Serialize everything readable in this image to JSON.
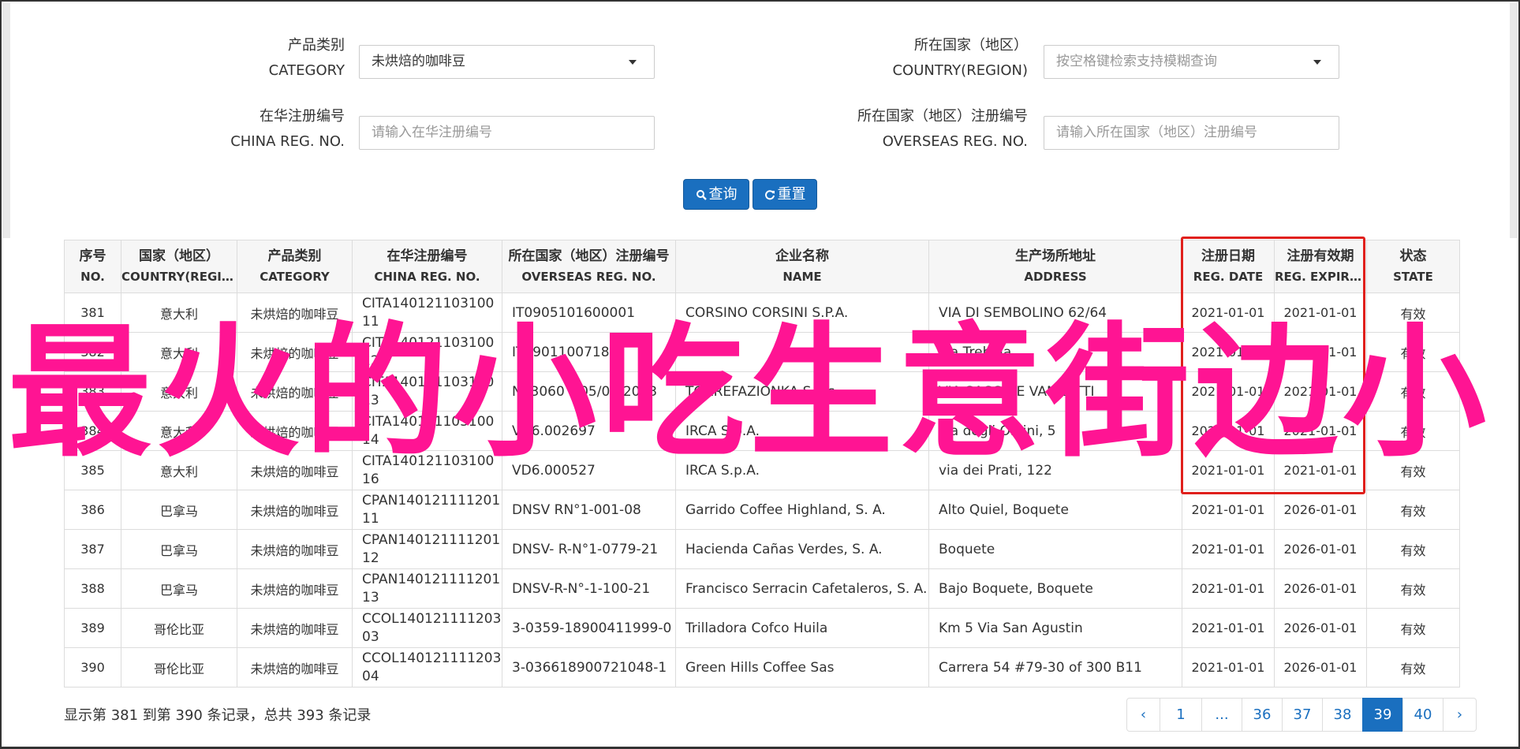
{
  "filters": {
    "category": {
      "label_cn": "产品类别",
      "label_en": "CATEGORY",
      "value": "未烘焙的咖啡豆"
    },
    "country": {
      "label_cn": "所在国家（地区）",
      "label_en": "COUNTRY(REGION)",
      "placeholder": "按空格键检索支持模糊查询"
    },
    "china_reg": {
      "label_cn": "在华注册编号",
      "label_en": "CHINA REG. NO.",
      "placeholder": "请输入在华注册编号"
    },
    "overseas_reg": {
      "label_cn": "所在国家（地区）注册编号",
      "label_en": "OVERSEAS REG. NO.",
      "placeholder": "请输入所在国家（地区）注册编号"
    },
    "search_label": "查询",
    "reset_label": "重置"
  },
  "table": {
    "headers": [
      {
        "cn": "序号",
        "en": "NO."
      },
      {
        "cn": "国家（地区）",
        "en": "COUNTRY(REGIO…"
      },
      {
        "cn": "产品类别",
        "en": "CATEGORY"
      },
      {
        "cn": "在华注册编号",
        "en": "CHINA REG. NO."
      },
      {
        "cn": "所在国家（地区）注册编号",
        "en": "OVERSEAS REG. NO."
      },
      {
        "cn": "企业名称",
        "en": "NAME"
      },
      {
        "cn": "生产场所地址",
        "en": "ADDRESS"
      },
      {
        "cn": "注册日期",
        "en": "REG. DATE"
      },
      {
        "cn": "注册有效期",
        "en": "REG. EXPIRE …"
      },
      {
        "cn": "状态",
        "en": "STATE"
      }
    ],
    "rows": [
      {
        "no": "381",
        "country": "意大利",
        "category": "未烘焙的咖啡豆",
        "china_reg": "CITA14012110310011",
        "overseas_reg": "IT0905101600001",
        "name": "CORSINO CORSINI S.P.A.",
        "address": "VIA DI SEMBOLINO 62/64",
        "reg_date": "2021-01-01",
        "expire": "2021-01-01",
        "state": "有效"
      },
      {
        "no": "382",
        "country": "意大利",
        "category": "未烘焙的咖啡豆",
        "china_reg": "CITA14012110310012",
        "overseas_reg": "IT0901100718",
        "name": "",
        "address": "via Trebbia",
        "reg_date": "2021-01-01",
        "expire": "2021-01-01",
        "state": "有效"
      },
      {
        "no": "383",
        "country": "意大利",
        "category": "未烘焙的咖啡豆",
        "china_reg": "CITA14012110310013",
        "overseas_reg": "N. 3060 – 05/07/2013",
        "name": "TORREFAZIONKA S.a.s.",
        "address": "VIA SACCO E VANZETTI",
        "reg_date": "2021-01-01",
        "expire": "2021-01-01",
        "state": "有效"
      },
      {
        "no": "384",
        "country": "意大利",
        "category": "未烘焙的咖啡豆",
        "china_reg": "CITA14012110310014",
        "overseas_reg": "VD6.002697",
        "name": "IRCA S.p.A.",
        "address": "via degli Orsini, 5",
        "reg_date": "2021-01-01",
        "expire": "2021-01-01",
        "state": "有效"
      },
      {
        "no": "385",
        "country": "意大利",
        "category": "未烘焙的咖啡豆",
        "china_reg": "CITA14012110310016",
        "overseas_reg": "VD6.000527",
        "name": "IRCA S.p.A.",
        "address": "via dei Prati, 122",
        "reg_date": "2021-01-01",
        "expire": "2021-01-01",
        "state": "有效"
      },
      {
        "no": "386",
        "country": "巴拿马",
        "category": "未烘焙的咖啡豆",
        "china_reg": "CPAN14012111120111",
        "overseas_reg": "DNSV RN°1-001-08",
        "name": "Garrido Coffee Highland, S. A.",
        "address": "Alto Quiel, Boquete",
        "reg_date": "2021-01-01",
        "expire": "2026-01-01",
        "state": "有效"
      },
      {
        "no": "387",
        "country": "巴拿马",
        "category": "未烘焙的咖啡豆",
        "china_reg": "CPAN14012111120112",
        "overseas_reg": "DNSV- R-N°1-0779-21",
        "name": "Hacienda Cañas Verdes, S. A.",
        "address": "Boquete",
        "reg_date": "2021-01-01",
        "expire": "2026-01-01",
        "state": "有效"
      },
      {
        "no": "388",
        "country": "巴拿马",
        "category": "未烘焙的咖啡豆",
        "china_reg": "CPAN14012111120113",
        "overseas_reg": "DNSV-R-N°-1-100-21",
        "name": "Francisco Serracin Cafetaleros, S. A.",
        "address": "Bajo Boquete, Boquete",
        "reg_date": "2021-01-01",
        "expire": "2026-01-01",
        "state": "有效"
      },
      {
        "no": "389",
        "country": "哥伦比亚",
        "category": "未烘焙的咖啡豆",
        "china_reg": "CCOL14012111120303",
        "overseas_reg": "3-0359-18900411999-0",
        "name": "Trilladora Cofco Huila",
        "address": "Km 5 Via San Agustin",
        "reg_date": "2021-01-01",
        "expire": "2026-01-01",
        "state": "有效"
      },
      {
        "no": "390",
        "country": "哥伦比亚",
        "category": "未烘焙的咖啡豆",
        "china_reg": "CCOL14012111120304",
        "overseas_reg": "3-036618900721048-1",
        "name": "Green Hills Coffee Sas",
        "address": "Carrera 54 #79-30 of 300 B11",
        "reg_date": "2021-01-01",
        "expire": "2026-01-01",
        "state": "有效"
      }
    ]
  },
  "summary": "显示第 381 到第 390 条记录，总共 393 条记录",
  "pager": [
    "‹",
    "1",
    "...",
    "36",
    "37",
    "38",
    "39",
    "40",
    "›"
  ],
  "pager_active": "39",
  "overlay_text": "最火的小吃生意街边小",
  "colors": {
    "primary": "#1a6fbf",
    "overlay": "#ff1493",
    "highlight_box": "#e0201c"
  }
}
